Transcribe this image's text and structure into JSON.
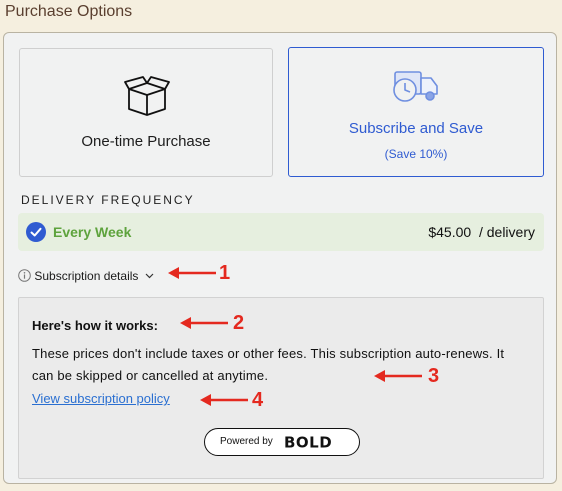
{
  "title": "Purchase Options",
  "options": {
    "one_time": {
      "label": "One-time Purchase",
      "icon": "open-box-icon"
    },
    "subscribe": {
      "label": "Subscribe and Save",
      "save": "(Save 10%)",
      "icon": "delivery-truck-clock-icon"
    }
  },
  "frequency": {
    "heading": "DELIVERY FREQUENCY",
    "selected_label": "Every Week",
    "price": "$45.00",
    "price_unit": "/ delivery"
  },
  "details": {
    "toggle_label": "Subscription details",
    "heading": "Here's how it works:",
    "body": "These prices don't include taxes or other fees. This subscription auto-renews. It can be skipped or cancelled at anytime.",
    "policy_link": "View subscription policy",
    "powered_by": "Powered by",
    "brand": "BOLD"
  },
  "annotations": [
    "1",
    "2",
    "3",
    "4"
  ],
  "colors": {
    "accent": "#2f5bd1",
    "selected_green": "#5ea33d",
    "callout_red": "#e4291f"
  }
}
